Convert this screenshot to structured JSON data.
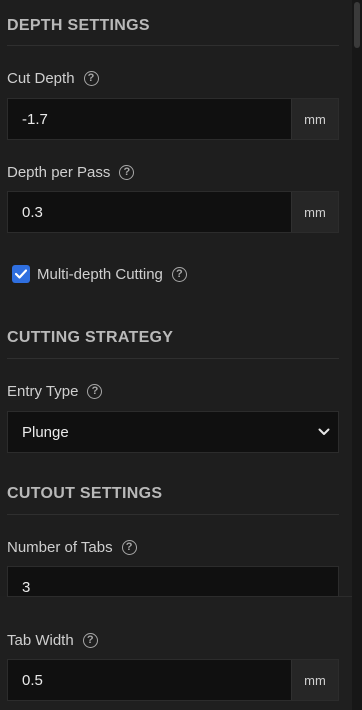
{
  "depth_settings": {
    "title": "DEPTH SETTINGS",
    "cut_depth": {
      "label": "Cut Depth",
      "value": "-1.7",
      "unit": "mm"
    },
    "depth_per_pass": {
      "label": "Depth per Pass",
      "value": "0.3",
      "unit": "mm"
    },
    "multi_depth": {
      "label": "Multi-depth Cutting",
      "checked": true
    }
  },
  "cutting_strategy": {
    "title": "CUTTING STRATEGY",
    "entry_type": {
      "label": "Entry Type",
      "selected": "Plunge"
    }
  },
  "cutout_settings": {
    "title": "CUTOUT SETTINGS",
    "number_of_tabs": {
      "label": "Number of Tabs",
      "value": "3"
    },
    "tab_width": {
      "label": "Tab Width",
      "value": "0.5",
      "unit": "mm"
    }
  },
  "icons": {
    "help": "question-circle-icon",
    "check": "checkmark-icon",
    "dropdown": "chevron-down-icon"
  },
  "colors": {
    "accent": "#2f6fe0",
    "panel_bg": "#1e1e1e",
    "input_bg": "#101010"
  }
}
